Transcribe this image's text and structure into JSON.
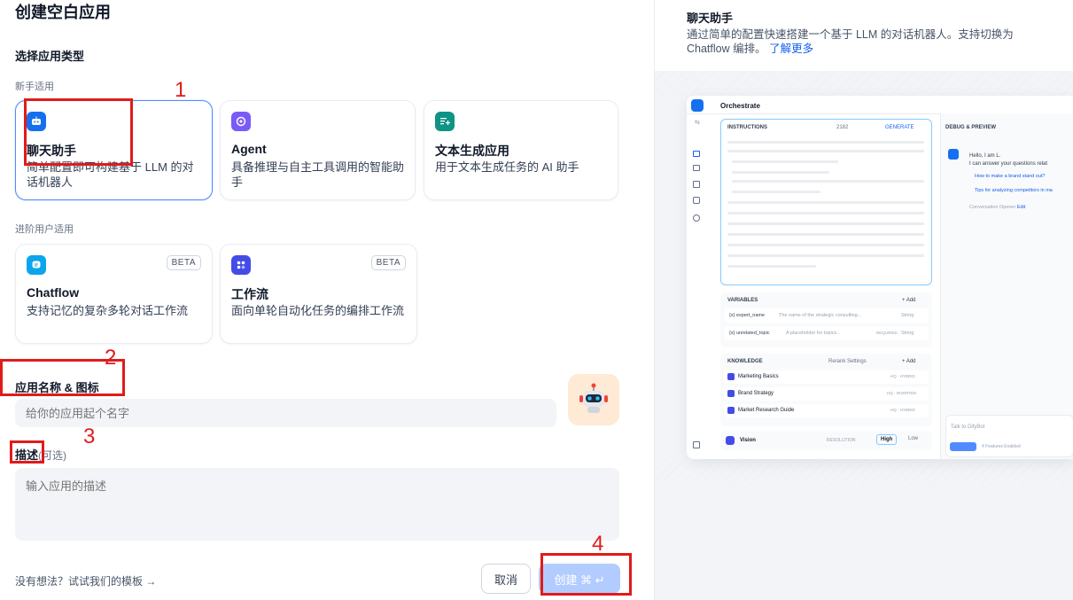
{
  "header": {
    "title": "创建空白应用"
  },
  "section_type": {
    "title": "选择应用类型",
    "beginner_label": "新手适用",
    "advanced_label": "进阶用户适用"
  },
  "app_types": [
    {
      "icon": "chat-bot-icon",
      "title": "聊天助手",
      "desc": "简单配置即可构建基于 LLM 的对话机器人",
      "color": "#1570ef"
    },
    {
      "icon": "agent-icon",
      "title": "Agent",
      "desc": "具备推理与自主工具调用的智能助手",
      "color": "#7a5af8"
    },
    {
      "icon": "text-generator-icon",
      "title": "文本生成应用",
      "desc": "用于文本生成任务的 AI 助手",
      "color": "#0e9384"
    },
    {
      "icon": "chatflow-icon",
      "title": "Chatflow",
      "desc": "支持记忆的复杂多轮对话工作流",
      "badge": "BETA",
      "color": "#0ba5ec"
    },
    {
      "icon": "workflow-icon",
      "title": "工作流",
      "desc": "面向单轮自动化任务的编排工作流",
      "badge": "BETA",
      "color": "#444ce7"
    }
  ],
  "name_section": {
    "label": "应用名称 & 图标",
    "placeholder": "给你的应用起个名字"
  },
  "desc_section": {
    "label": "描述",
    "optional": "(可选)",
    "placeholder": "输入应用的描述"
  },
  "footer": {
    "template_link": "没有想法？试试我们的模板 →",
    "cancel": "取消",
    "create": "创建 ⌘ ↵"
  },
  "annotations": {
    "n1": "1",
    "n2": "2",
    "n3": "3",
    "n4": "4"
  },
  "info": {
    "title": "聊天助手",
    "desc": "通过简单的配置快速搭建一个基于 LLM 的对话机器人。支持切换为 Chatflow 编排。",
    "learn_more": "了解更多"
  },
  "preview": {
    "header": "Orchestrate",
    "instructions": "INSTRUCTIONS",
    "count": "2182",
    "generate": "GENERATE",
    "debug": "DEBUG & PREVIEW",
    "bot_hello": "Hello, I am L.",
    "bot_line2": "I can answer your questions relat",
    "q1": "How to make a brand stand out?",
    "q2": "Tips for analyzing competitors in ma",
    "opener": "Conversation Opener",
    "edit": "Edit",
    "variables": "VARIABLES",
    "add": "+ Add",
    "var1_name": "{x} expert_name",
    "var1_desc": "The name of the strategic consulting...",
    "var1_type": "String",
    "var2_name": "{x} unrelated_topic",
    "var2_desc": "A placeholder for topics...",
    "var2_req": "REQUIRED",
    "var2_type": "String",
    "knowledge": "KNOWLEDGE",
    "rerank": "Rerank Settings",
    "k1": "Marketing Basics",
    "k1_tag": "HQ · HYBRID",
    "k2": "Brand Strategy",
    "k2_tag": "HQ · INVERTED",
    "k3": "Market Research Guide",
    "k3_tag": "HQ · HYBRID",
    "vision": "Vision",
    "resolution": "RESOLUTION",
    "high": "High",
    "low": "Low",
    "talk": "Talk to DifyBot",
    "features": "4 Features Enabled"
  }
}
